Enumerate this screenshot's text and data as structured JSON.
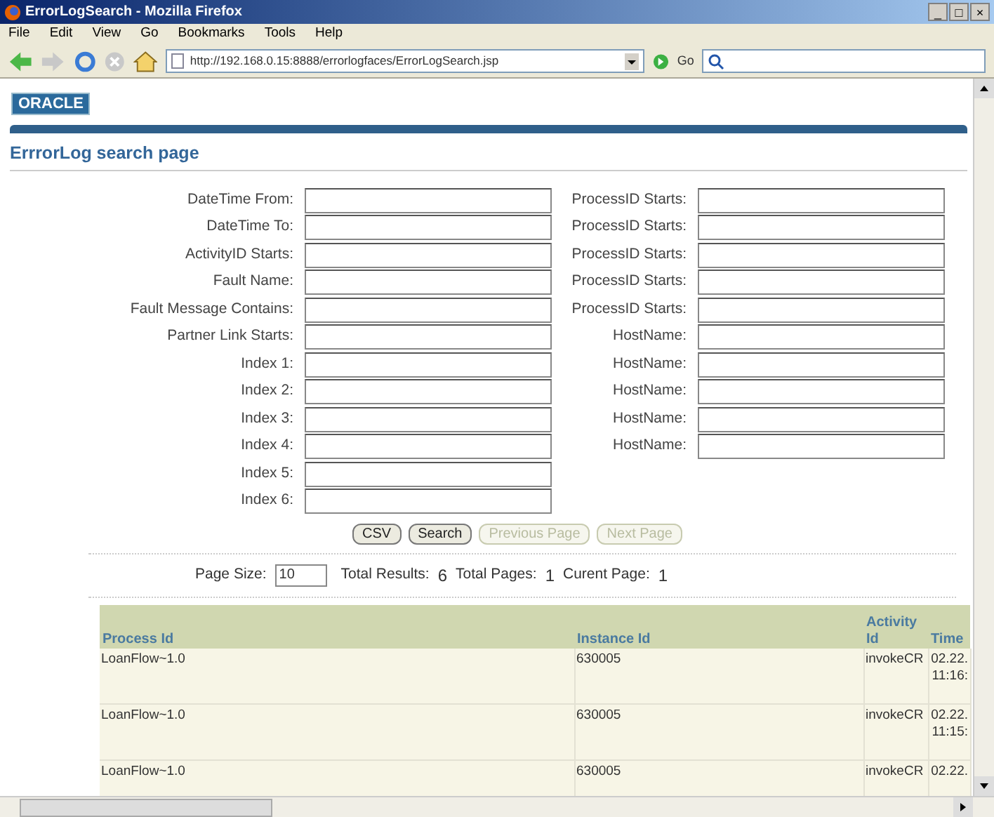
{
  "window": {
    "title": "ErrorLogSearch - Mozilla Firefox",
    "controls": [
      "_",
      "□",
      "×"
    ]
  },
  "menu": [
    "File",
    "Edit",
    "View",
    "Go",
    "Bookmarks",
    "Tools",
    "Help"
  ],
  "toolbar": {
    "url": "http://192.168.0.15:8888/errorlogfaces/ErrorLogSearch.jsp",
    "go": "Go"
  },
  "logo": "ORACLE",
  "heading": "ErrrorLog search page",
  "left_fields": [
    "DateTime From:",
    "DateTime To:",
    "ActivityID Starts:",
    "Fault Name:",
    "Fault Message Contains:",
    "Partner Link Starts:",
    "Index 1:",
    "Index 2:",
    "Index 3:",
    "Index 4:",
    "Index 5:",
    "Index 6:"
  ],
  "right_fields": [
    "ProcessID Starts:",
    "ProcessID Starts:",
    "ProcessID Starts:",
    "ProcessID Starts:",
    "ProcessID Starts:",
    "HostName:",
    "HostName:",
    "HostName:",
    "HostName:",
    "HostName:"
  ],
  "buttons": [
    {
      "label": "CSV",
      "disabled": false
    },
    {
      "label": "Search",
      "disabled": false
    },
    {
      "label": "Previous Page",
      "disabled": true
    },
    {
      "label": "Next Page",
      "disabled": true
    }
  ],
  "paging": {
    "page_size_label": "Page Size:",
    "page_size": "10",
    "total_results_label": "Total Results:",
    "total_results": "6",
    "total_pages_label": "Total Pages:",
    "total_pages": "1",
    "current_page_label": "Curent Page:",
    "current_page": "1"
  },
  "table": {
    "columns": [
      "Process Id",
      "Instance Id",
      "Activity Id",
      "Time"
    ],
    "rows": [
      [
        "LoanFlow~1.0",
        "630005",
        "invokeCR",
        "02.22. 11:16:"
      ],
      [
        "LoanFlow~1.0",
        "630005",
        "invokeCR",
        "02.22. 11:15:"
      ],
      [
        "LoanFlow~1.0",
        "630005",
        "invokeCR",
        "02.22."
      ]
    ]
  }
}
